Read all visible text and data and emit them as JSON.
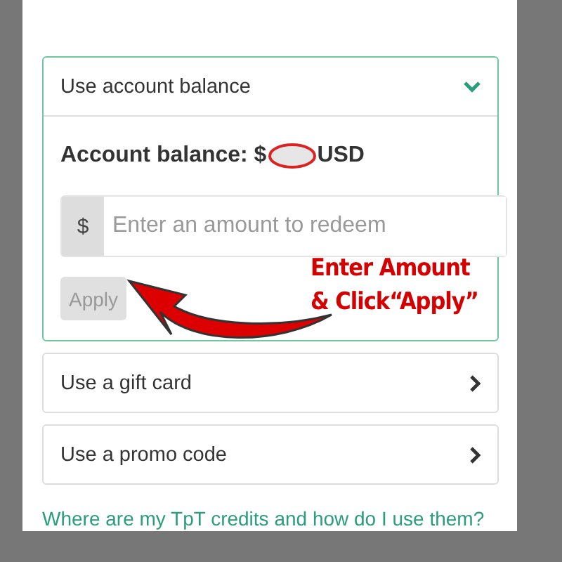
{
  "account_balance": {
    "title": "Use account balance",
    "expanded": true,
    "label": "Account balance: $",
    "currency": "USD",
    "input": {
      "prefix": "$",
      "placeholder": "Enter an amount to redeem"
    },
    "apply": {
      "label": "Apply",
      "disabled": true
    }
  },
  "options": [
    {
      "label": "Use a gift card"
    },
    {
      "label": "Use a promo code"
    }
  ],
  "help_link": "Where are my TpT credits and how do I use them?",
  "annotation": {
    "lines": [
      "Enter Amount",
      "& Click“Apply”"
    ]
  }
}
